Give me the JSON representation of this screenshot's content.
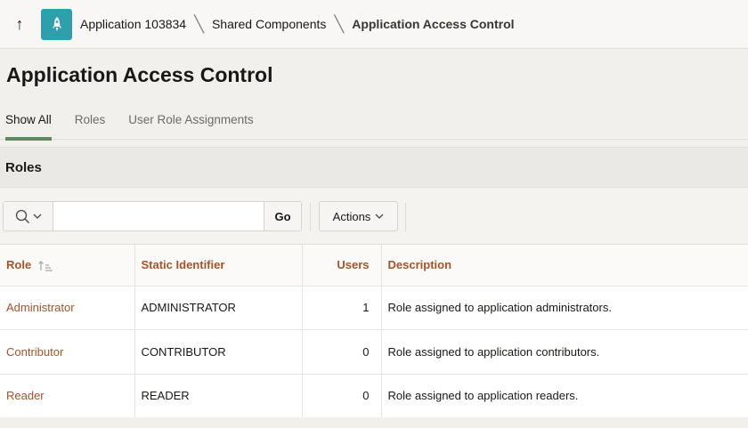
{
  "breadcrumb": {
    "up_label": "↑",
    "app": "Application 103834",
    "shared": "Shared Components",
    "current": "Application Access Control"
  },
  "page": {
    "title": "Application Access Control"
  },
  "tabs": [
    {
      "label": "Show All",
      "active": true
    },
    {
      "label": "Roles",
      "active": false
    },
    {
      "label": "User Role Assignments",
      "active": false
    }
  ],
  "section": {
    "title": "Roles"
  },
  "toolbar": {
    "search_placeholder": "",
    "search_value": "",
    "go_label": "Go",
    "actions_label": "Actions"
  },
  "table": {
    "columns": [
      "Role",
      "Static Identifier",
      "Users",
      "Description"
    ],
    "rows": [
      [
        "Administrator",
        "ADMINISTRATOR",
        "1",
        "Role assigned to application administrators."
      ],
      [
        "Contributor",
        "CONTRIBUTOR",
        "0",
        "Role assigned to application contributors."
      ],
      [
        "Reader",
        "READER",
        "0",
        "Role assigned to application readers."
      ]
    ]
  },
  "colors": {
    "accent": "#a4532a",
    "tab_indicator": "#5d8a5e",
    "app_icon": "#309fac"
  }
}
